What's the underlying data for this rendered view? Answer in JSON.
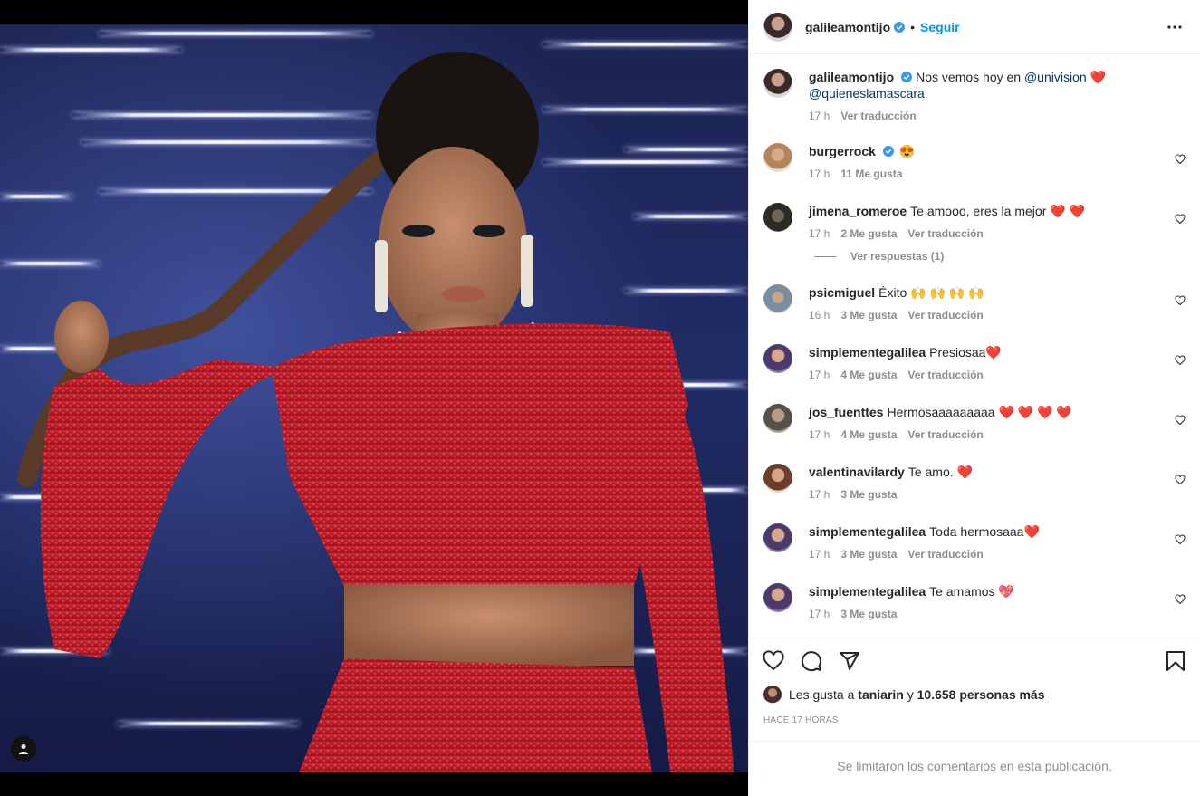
{
  "post": {
    "author": "galileamontijo",
    "follow_label": "Seguir",
    "dot": "•",
    "caption_text": "Nos vemos hoy en ",
    "caption_mention_1": "@univision",
    "caption_heart": "❤️",
    "caption_mention_2": "@quieneslamascara",
    "caption_time": "17 h",
    "caption_translate": "Ver traducción"
  },
  "comments": [
    {
      "user": "burgerrock",
      "verified": true,
      "text": "😍",
      "time": "17 h",
      "likes": "11 Me gusta",
      "translate": ""
    },
    {
      "user": "jimena_romeroe",
      "verified": false,
      "text": "Te amooo, eres la mejor ❤️ ❤️",
      "time": "17 h",
      "likes": "2 Me gusta",
      "translate": "Ver traducción"
    },
    {
      "user": "psicmiguel",
      "verified": false,
      "text": "Éxito 🙌 🙌 🙌 🙌",
      "time": "16 h",
      "likes": "3 Me gusta",
      "translate": "Ver traducción"
    },
    {
      "user": "simplementegalilea",
      "verified": false,
      "text": "Presiosaa❤️",
      "time": "17 h",
      "likes": "4 Me gusta",
      "translate": "Ver traducción"
    },
    {
      "user": "jos_fuenttes",
      "verified": false,
      "text": "Hermosaaaaaaaaa ❤️ ❤️ ❤️ ❤️",
      "time": "17 h",
      "likes": "4 Me gusta",
      "translate": "Ver traducción"
    },
    {
      "user": "valentinavilardy",
      "verified": false,
      "text": "Te amo. ❤️",
      "time": "17 h",
      "likes": "3 Me gusta",
      "translate": ""
    },
    {
      "user": "simplementegalilea",
      "verified": false,
      "text": "Toda hermosaaa❤️",
      "time": "17 h",
      "likes": "3 Me gusta",
      "translate": "Ver traducción"
    },
    {
      "user": "simplementegalilea",
      "verified": false,
      "text": "Te amamos 💖",
      "time": "17 h",
      "likes": "3 Me gusta",
      "translate": ""
    }
  ],
  "view_replies": "Ver respuestas (1)",
  "likes_line": {
    "prefix": "Les gusta a ",
    "user": "taniarin",
    "middle": " y ",
    "count": "10.658 personas más"
  },
  "time_ago": "HACE 17 HORAS",
  "comments_limited": "Se limitaron los comentarios en esta publicación.",
  "icons": [
    "more-options-icon",
    "heart-icon",
    "comment-icon",
    "share-icon",
    "bookmark-icon",
    "user-tag-icon",
    "verified-badge-icon"
  ],
  "colors": {
    "accent": "#0095f6",
    "mention": "#00376b",
    "muted": "#8e8e8e",
    "verified": "#3897f0"
  }
}
